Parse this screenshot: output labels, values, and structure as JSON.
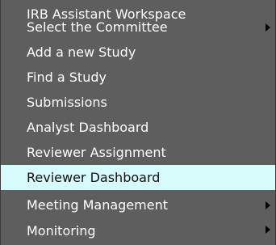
{
  "menu": {
    "items": [
      {
        "label": "IRB Assistant Workspace",
        "has_submenu": false,
        "active": false
      },
      {
        "label": "Select the Committee",
        "has_submenu": true,
        "active": false
      },
      {
        "label": "Add a new Study",
        "has_submenu": false,
        "active": false
      },
      {
        "label": "Find a Study",
        "has_submenu": false,
        "active": false
      },
      {
        "label": "Submissions",
        "has_submenu": false,
        "active": false
      },
      {
        "label": "Analyst Dashboard",
        "has_submenu": false,
        "active": false
      },
      {
        "label": "Reviewer Assignment",
        "has_submenu": false,
        "active": false
      },
      {
        "label": "Reviewer Dashboard",
        "has_submenu": false,
        "active": true
      },
      {
        "label": "Meeting Management",
        "has_submenu": true,
        "active": false
      },
      {
        "label": "Monitoring",
        "has_submenu": true,
        "active": false
      }
    ],
    "submenu_icon": "chevron-right-icon",
    "colors": {
      "background": "#5e5e5e",
      "text": "#ffffff",
      "active_background": "#d7fbfb",
      "active_text": "#111111"
    }
  }
}
